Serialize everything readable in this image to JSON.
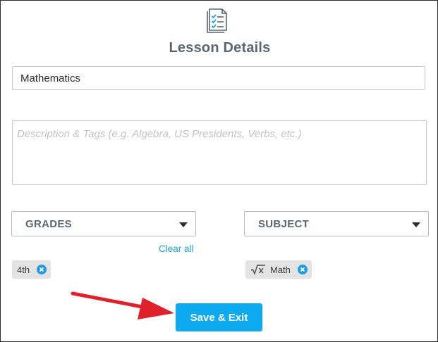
{
  "header": {
    "icon": "checklist-document-icon",
    "title": "Lesson Details"
  },
  "form": {
    "name_value": "Mathematics",
    "description_placeholder": "Description & Tags (e.g. Algebra, US Presidents, Verbs, etc.)",
    "grades_label": "GRADES",
    "subject_label": "SUBJECT",
    "clear_all_label": "Clear all",
    "grade_chips": [
      "4th"
    ],
    "subject_chips": [
      {
        "icon": "square-root-icon",
        "label": "Math"
      }
    ]
  },
  "actions": {
    "save_label": "Save & Exit"
  },
  "colors": {
    "accent": "#0eaaf0",
    "chip_remove": "#1e9be0",
    "title_text": "#5b6770",
    "annotation_arrow": "#e0202a"
  }
}
